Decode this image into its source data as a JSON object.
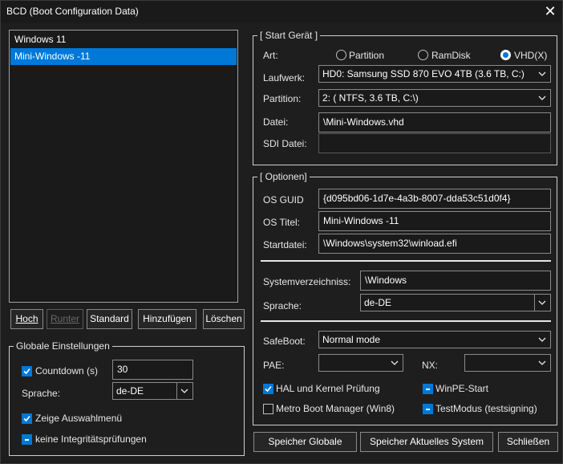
{
  "window": {
    "title": "BCD (Boot Configuration Data)",
    "close_glyph": "✕"
  },
  "entries": {
    "items": [
      "Windows 11",
      "Mini-Windows -11"
    ],
    "selected_index": 1
  },
  "list_buttons": {
    "up": "Hoch",
    "down": "Runter",
    "default": "Standard",
    "add": "Hinzufügen",
    "delete": "Löschen"
  },
  "global": {
    "title": "Globale Einstellungen",
    "countdown_label": "Countdown (s)",
    "countdown_value": "30",
    "countdown_checked": true,
    "language_label": "Sprache:",
    "language_value": "de-DE",
    "show_menu_label": "Zeige Auswahlmenü",
    "show_menu_checked": true,
    "no_integrity_label": "keine Integritätsprüfungen",
    "no_integrity_state": "indeterminate"
  },
  "start_device": {
    "title": "[ Start Gerät ]",
    "type_label": "Art:",
    "types": [
      "Partition",
      "RamDisk",
      "VHD(X)"
    ],
    "selected_type": "VHD(X)",
    "drive_label": "Laufwerk:",
    "drive_value": "HD0: Samsung SSD 870 EVO 4TB (3.6 TB, C:)",
    "partition_label": "Partition:",
    "partition_value": "2: ( NTFS,   3.6 TB, C:\\)",
    "file_label": "Datei:",
    "file_value": "\\Mini-Windows.vhd",
    "sdi_label": "SDI Datei:",
    "sdi_value": ""
  },
  "options": {
    "title": "[ Optionen]",
    "guid_label": "OS GUID",
    "guid_value": "{d095bd06-1d7e-4a3b-8007-dda53c51d0f4}",
    "os_title_label": "OS Titel:",
    "os_title_value": "Mini-Windows -11",
    "startfile_label": "Startdatei:",
    "startfile_value": "\\Windows\\system32\\winload.efi",
    "sysdir_label": "Systemverzeichniss:",
    "sysdir_value": "\\Windows",
    "lang_label": "Sprache:",
    "lang_value": "de-DE",
    "safeboot_label": "SafeBoot:",
    "safeboot_value": "Normal mode",
    "pae_label": "PAE:",
    "pae_value": "",
    "nx_label": "NX:",
    "nx_value": "",
    "hal_label": "HAL und Kernel Prüfung",
    "hal_checked": true,
    "winpe_label": "WinPE-Start",
    "winpe_state": "indeterminate",
    "metro_label": "Metro Boot Manager (Win8)",
    "metro_checked": false,
    "testmode_label": "TestModus (testsigning)",
    "testmode_state": "indeterminate"
  },
  "bottom_buttons": {
    "save_global": "Speicher Globale",
    "save_current": "Speicher Aktuelles System",
    "close": "Schließen"
  },
  "colors": {
    "accent": "#0078d7",
    "background": "#1e1e1e",
    "text": "#e6e6e6"
  }
}
